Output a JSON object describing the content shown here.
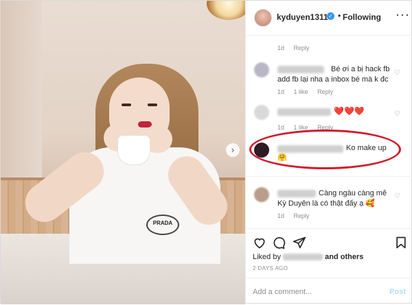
{
  "header": {
    "username": "kyduyen1311",
    "separator": "•",
    "follow_label": "Following",
    "more_label": "···"
  },
  "comments": [
    {
      "time": "1d",
      "reply": "Reply"
    },
    {
      "text": "Bé ơi a bị hack fb add fb lại nha a inbox bé mà k đc",
      "time": "1d",
      "likes": "1 like",
      "reply": "Reply"
    },
    {
      "text": "❤️❤️❤️",
      "time": "1d",
      "likes": "1 like",
      "reply": "Reply"
    },
    {
      "text": "Ko make up",
      "emoji": "🤗"
    },
    {
      "text": "Càng ngàu càng mê Kỳ Duyên là có thật đấy ạ 🥰",
      "time": "1d",
      "reply": "Reply"
    }
  ],
  "likes": {
    "prefix": "Liked by",
    "suffix": "and others"
  },
  "date": "2 DAYS AGO",
  "comment_box": {
    "placeholder": "Add a comment...",
    "post_label": "Post"
  },
  "photo": {
    "shirt_logo": "PRADA"
  },
  "colors": {
    "annotation": "#d21a2a",
    "verified": "#3897f0",
    "post_disabled": "#b2dffc"
  }
}
